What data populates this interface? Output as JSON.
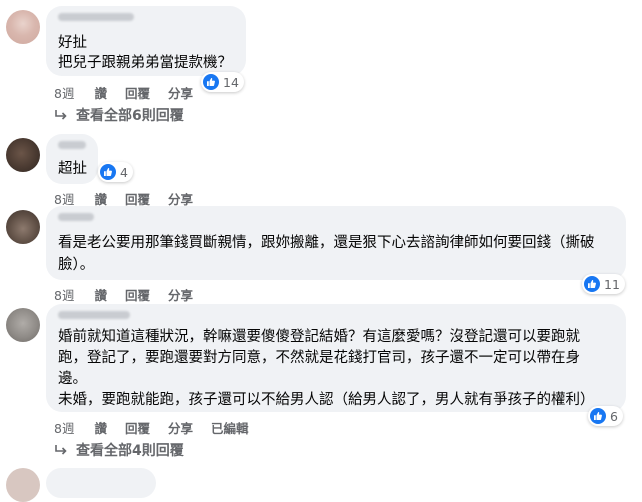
{
  "comments": [
    {
      "lines": [
        "好扯",
        "把兒子跟親弟弟當提款機？"
      ],
      "reaction_count": "14",
      "time": "8週",
      "like": "讚",
      "reply": "回覆",
      "share": "分享"
    },
    {
      "lines": [
        "超扯"
      ],
      "reaction_count": "4",
      "time": "8週",
      "like": "讚",
      "reply": "回覆",
      "share": "分享"
    },
    {
      "lines": [
        "看是老公要用那筆錢買斷親情，跟妳搬離，還是狠下心去諮詢律師如何要回錢（撕破",
        "臉）。"
      ],
      "reaction_count": "11",
      "time": "8週",
      "like": "讚",
      "reply": "回覆",
      "share": "分享"
    },
    {
      "lines": [
        "婚前就知道這種狀況，幹嘛還要傻傻登記結婚？有這麼愛嗎？沒登記還可以要跑就",
        "跑，登記了，要跑還要對方同意，不然就是花錢打官司，孩子還不一定可以帶在身",
        "邊。",
        "未婚，要跑就能跑，孩子還可以不給男人認（給男人認了，男人就有爭孩子的權利）"
      ],
      "reaction_count": "6",
      "time": "8週",
      "like": "讚",
      "reply": "回覆",
      "share": "分享",
      "edited": "已編輯"
    }
  ],
  "view_all_replies_1": "查看全部6則回覆",
  "view_all_replies_2": "查看全部4則回覆",
  "colors": {
    "bubble": "#f0f2f5",
    "like_blue": "#1877f2",
    "meta_gray": "#65676b"
  },
  "icons": [
    "like-icon",
    "reply-arrow-icon"
  ]
}
